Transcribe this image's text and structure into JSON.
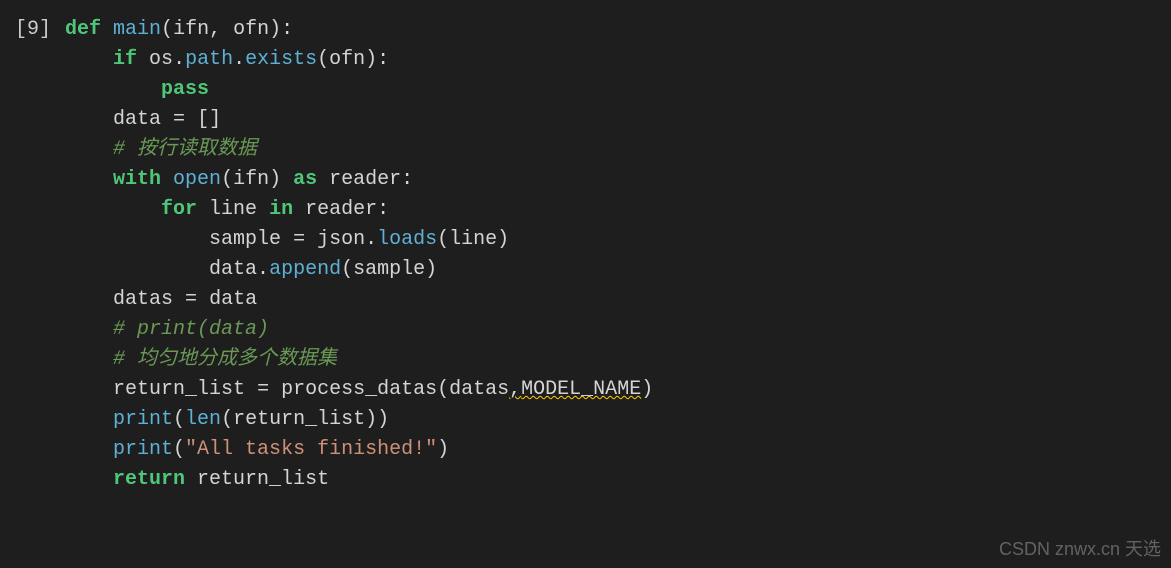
{
  "cell": "[9]",
  "tokens": {
    "def": "def",
    "main": "main",
    "ifn": "ifn",
    "ofn": "ofn",
    "if": "if",
    "os": "os",
    "path": "path",
    "exists": "exists",
    "pass": "pass",
    "data": "data",
    "eq": "=",
    "brackets": "[]",
    "comment1": "# 按行读取数据",
    "with": "with",
    "open": "open",
    "as": "as",
    "reader": "reader",
    "for": "for",
    "line": "line",
    "in": "in",
    "sample": "sample",
    "json": "json",
    "loads": "loads",
    "append": "append",
    "datas": "datas",
    "comment2": "# print(data)",
    "comment3": "# 均匀地分成多个数据集",
    "return_list": "return_list",
    "process_datas": "process_datas",
    "model_name": "MODEL_NAME",
    "print": "print",
    "len": "len",
    "str_finished": "\"All tasks finished!\"",
    "return": "return"
  },
  "watermark": "CSDN  znwx.cn 天选"
}
